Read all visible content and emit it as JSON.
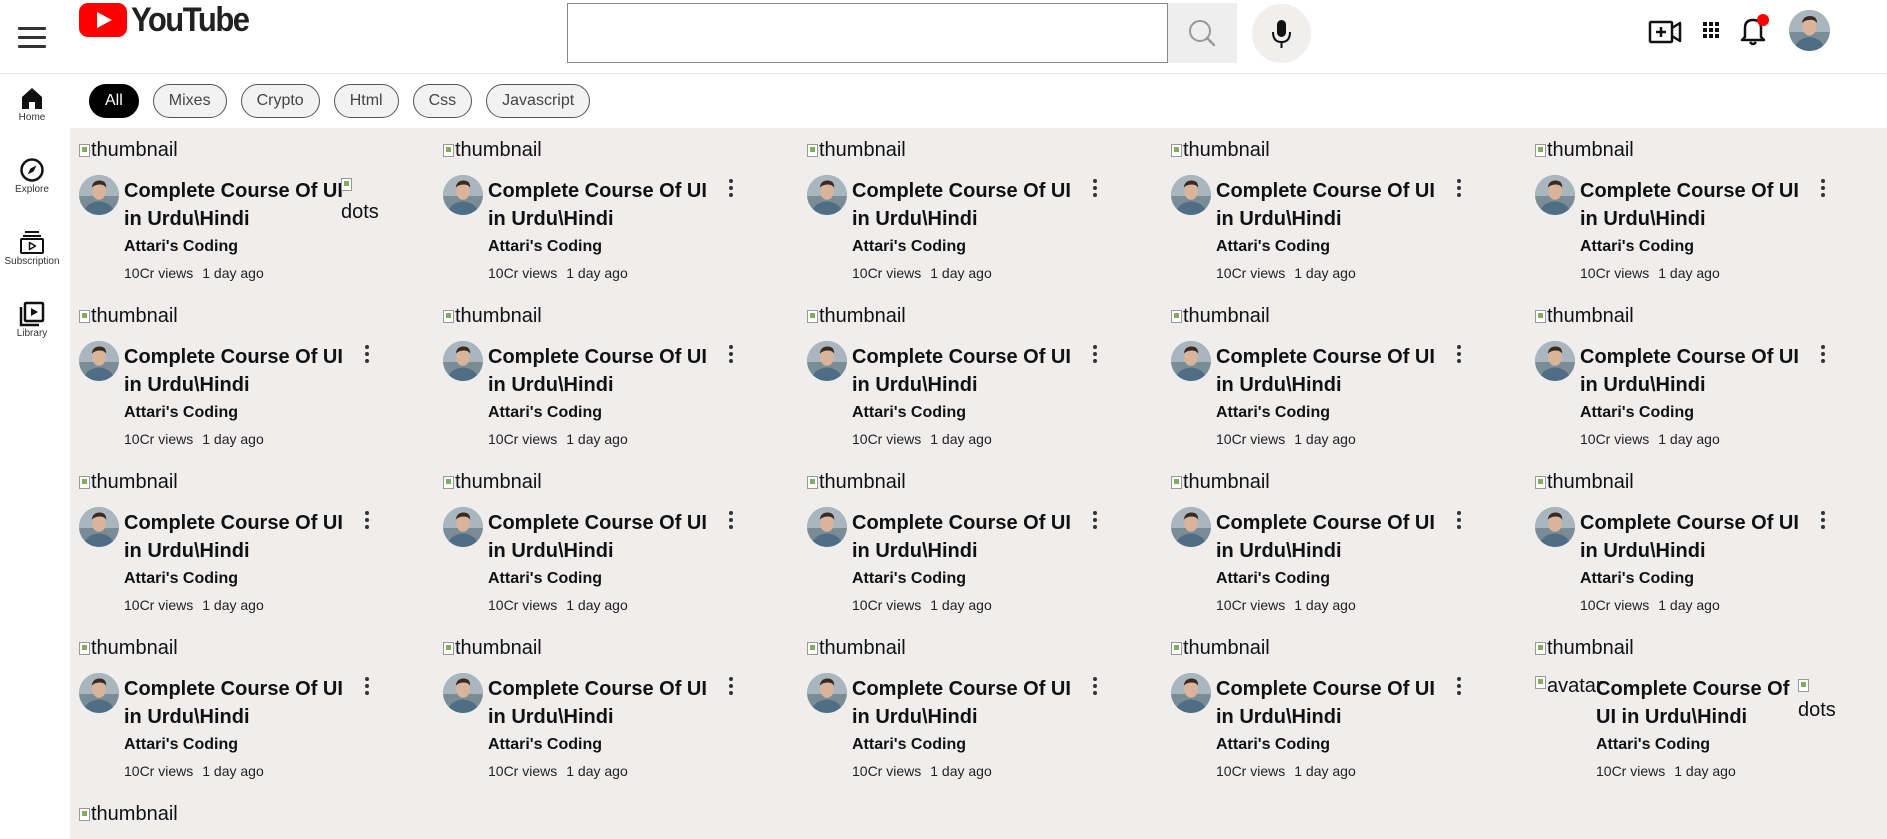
{
  "header": {
    "logo_text": "YouTube",
    "search_placeholder": "",
    "icons": [
      "menu-icon",
      "search-icon",
      "mic-icon",
      "video-create-icon",
      "apps-icon",
      "bell-icon"
    ],
    "notification_dot_color": "#ff0000"
  },
  "chips": [
    "All",
    "Mixes",
    "Crypto",
    "Html",
    "Css",
    "Javascript"
  ],
  "sidebar": {
    "items": [
      {
        "label": "Home",
        "icon": "home-icon"
      },
      {
        "label": "Explore",
        "icon": "compass-icon"
      },
      {
        "label": "Subscription",
        "icon": "subscriptions-icon"
      },
      {
        "label": "Library",
        "icon": "library-icon"
      }
    ]
  },
  "video": {
    "thumb_alt": "thumbnail",
    "dots_alt": "dots",
    "avatar_alt": "avatar",
    "title": "Complete Course Of UI in Urdu\\Hindi",
    "channel": "Attari's Coding",
    "views": "10Cr views",
    "age": "1 day ago"
  },
  "grid": {
    "rows": 4,
    "cols": 5,
    "extra_thumbs": 1
  },
  "colors": {
    "accent": "#ff0000",
    "content_bg": "#f0eded",
    "chip_active_bg": "#000000"
  }
}
